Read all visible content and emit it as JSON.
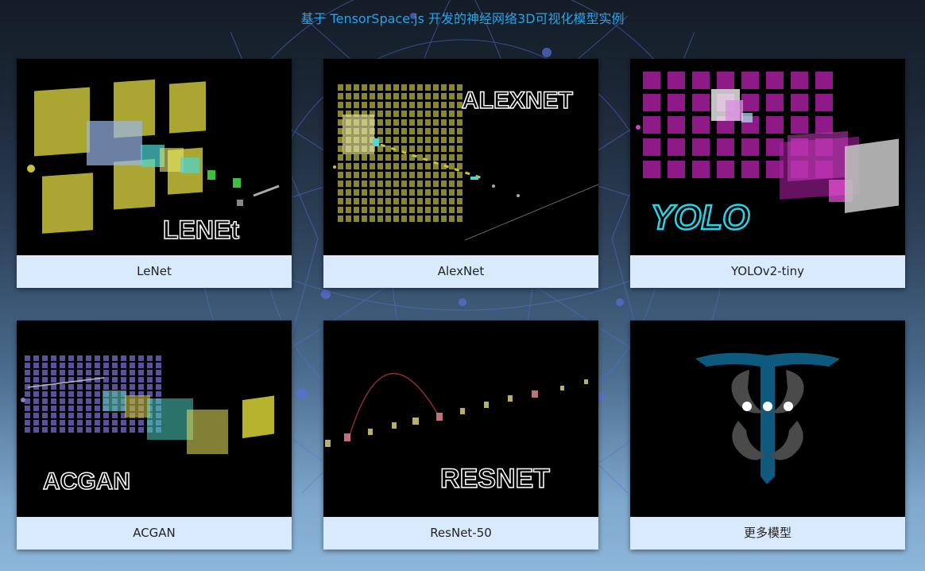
{
  "page": {
    "title": "基于 TensorSpace.js 开发的神经网络3D可视化模型实例"
  },
  "colors": {
    "title": "#29a3e8",
    "card_label_bg": "#d8eafb",
    "network_lines": "#5a6fd6"
  },
  "models": [
    {
      "label": "LeNet",
      "logo_text": "LENEt",
      "icon": "lenet-thumbnail"
    },
    {
      "label": "AlexNet",
      "logo_text": "ALEXNET",
      "icon": "alexnet-thumbnail"
    },
    {
      "label": "YOLOv2-tiny",
      "logo_text": "YOLO",
      "icon": "yolo-thumbnail"
    },
    {
      "label": "ACGAN",
      "logo_text": "ACGAN",
      "icon": "acgan-thumbnail"
    },
    {
      "label": "ResNet-50",
      "logo_text": "RESNET",
      "icon": "resnet-thumbnail"
    },
    {
      "label": "更多模型",
      "logo_text": "TS",
      "icon": "tensorspace-logo"
    }
  ]
}
